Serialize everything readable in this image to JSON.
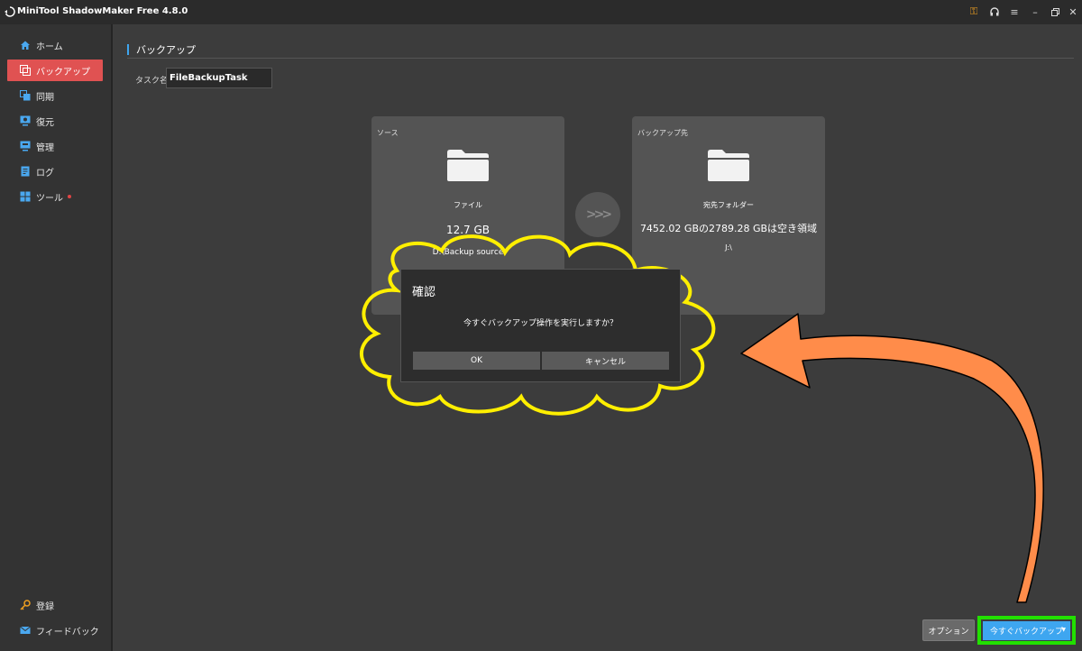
{
  "titlebar": {
    "title": "MiniTool ShadowMaker Free 4.8.0",
    "buttons": [
      "key-icon",
      "headset-icon",
      "menu-icon",
      "minimize-icon",
      "restore-icon",
      "close-icon"
    ]
  },
  "sidebar": {
    "items": [
      {
        "label": "ホーム",
        "icon": "home-icon"
      },
      {
        "label": "バックアップ",
        "icon": "backup-icon",
        "active": true
      },
      {
        "label": "同期",
        "icon": "sync-icon"
      },
      {
        "label": "復元",
        "icon": "restore-icon"
      },
      {
        "label": "管理",
        "icon": "manage-icon"
      },
      {
        "label": "ログ",
        "icon": "log-icon"
      },
      {
        "label": "ツール",
        "icon": "tools-icon",
        "badge": true
      }
    ],
    "bottom": [
      {
        "label": "登録",
        "icon": "key-icon"
      },
      {
        "label": "フィードバック",
        "icon": "mail-icon"
      }
    ]
  },
  "main": {
    "section_title": "バックアップ",
    "task_label": "タスク名:",
    "task_name": "FileBackupTask",
    "source": {
      "label": "ソース",
      "type": "ファイル",
      "size": "12.7 GB",
      "path": "D:\\Backup source"
    },
    "destination": {
      "label": "バックアップ先",
      "type": "宛先フォルダー",
      "space": "7452.02 GBの2789.28 GBは空き領域",
      "path": "J:\\"
    },
    "arrow": ">>>",
    "option_button": "オプション",
    "backup_now_button": "今すぐバックアップ"
  },
  "dialog": {
    "title": "確認",
    "message": "今すぐバックアップ操作を実行しますか？",
    "ok": "OK",
    "cancel": "キャンセル"
  },
  "colors": {
    "accent": "#3ea6f0",
    "active_nav": "#e05252",
    "highlight_frame": "#22e000",
    "callout_outline": "#ffef00",
    "arrow_fill": "#ff8c4a"
  }
}
